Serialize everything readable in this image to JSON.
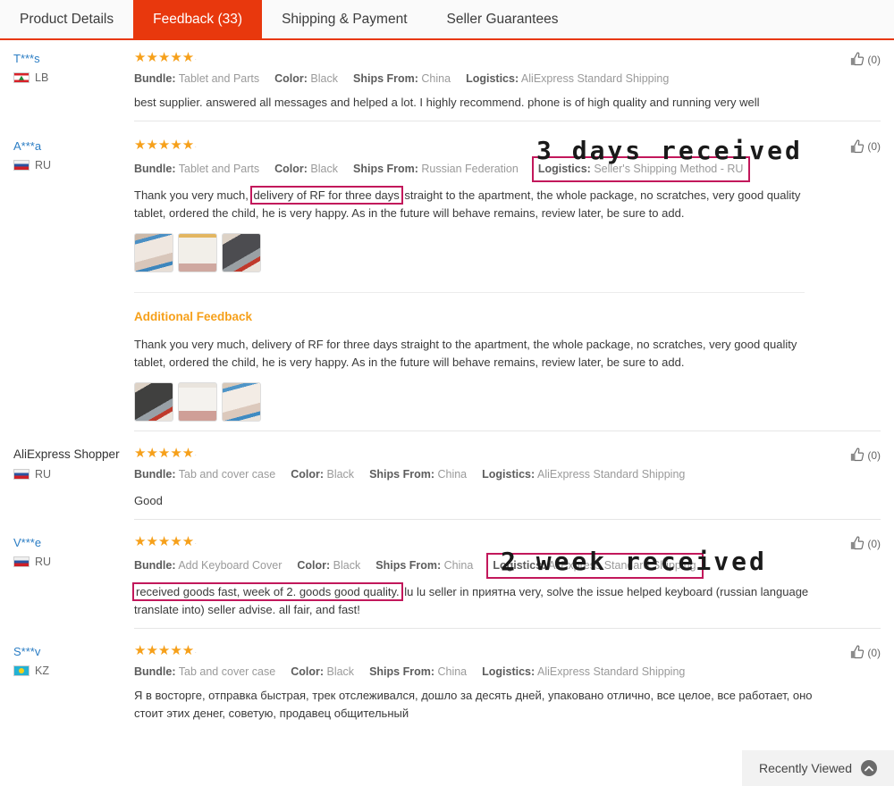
{
  "tabs": [
    {
      "label": "Product Details",
      "active": false
    },
    {
      "label": "Feedback (33)",
      "active": true
    },
    {
      "label": "Shipping & Payment",
      "active": false
    },
    {
      "label": "Seller Guarantees",
      "active": false
    }
  ],
  "labels": {
    "bundle": "Bundle:",
    "color": "Color:",
    "ships_from": "Ships From:",
    "logistics": "Logistics:",
    "additional_feedback": "Additional Feedback",
    "stars": "★★★★★"
  },
  "reviews": [
    {
      "user": "T***s",
      "country_code": "LB",
      "country_flag": "flag-lb",
      "rating": 5,
      "bundle": "Tablet and Parts",
      "color": "Black",
      "ships_from": "China",
      "logistics": "AliExpress Standard Shipping",
      "text": "best supplier. answered all messages and helped a lot. I highly recommend. phone is of high quality and running very well",
      "helpful_count": "(0)"
    },
    {
      "user": "A***a",
      "country_code": "RU",
      "country_flag": "flag-ru",
      "rating": 5,
      "bundle": "Tablet and Parts",
      "color": "Black",
      "ships_from": "Russian Federation",
      "logistics": "Seller's Shipping Method - RU",
      "text_before": "Thank you very much, ",
      "text_highlight": "delivery of RF for three days",
      "text_after": " straight to the apartment, the whole package, no scratches, very good quality tablet, ordered the child, he is very happy. As in the future will behave remains, review later, be sure to add.",
      "helpful_count": "(0)",
      "additional": {
        "title": "Additional Feedback",
        "text": "Thank you very much, delivery of RF for three days straight to the apartment, the whole package, no scratches, very good quality tablet, ordered the child, he is very happy. As in the future will behave remains, review later, be sure to add."
      }
    },
    {
      "user": "AliExpress Shopper",
      "country_code": "RU",
      "country_flag": "flag-ru",
      "rating": 5,
      "bundle": "Tab and cover case",
      "color": "Black",
      "ships_from": "China",
      "logistics": "AliExpress Standard Shipping",
      "text": "Good",
      "helpful_count": "(0)"
    },
    {
      "user": "V***e",
      "country_code": "RU",
      "country_flag": "flag-ru",
      "rating": 5,
      "bundle": "Add Keyboard Cover",
      "color": "Black",
      "ships_from": "China",
      "logistics": "AliExpress Standard Shipping",
      "text_highlight": "received goods fast, week of 2. goods good quality.",
      "text_after": " lu lu seller in приятна very, solve the issue helped keyboard (russian language translate into) seller advise. all fair, and fast!",
      "helpful_count": "(0)"
    },
    {
      "user": "S***v",
      "country_code": "KZ",
      "country_flag": "flag-kz",
      "rating": 5,
      "bundle": "Tab and cover case",
      "color": "Black",
      "ships_from": "China",
      "logistics": "AliExpress Standard Shipping",
      "text": "Я в восторге, отправка быстрая, трек отслеживался, дошло за десять дней, упаковано отлично, все целое, все работает, оно стоит этих денег, советую, продавец общительный",
      "helpful_count": "(0)"
    }
  ],
  "annotations": [
    {
      "id": "annot-3days",
      "text": "3 days received"
    },
    {
      "id": "annot-2week",
      "text": "2 week received"
    }
  ],
  "footer": {
    "recently_viewed": "Recently Viewed"
  },
  "colors": {
    "active_tab": "#e8380d",
    "star": "#f6a01a",
    "annotation_box": "#c2185b",
    "link": "#2b7dc4"
  }
}
